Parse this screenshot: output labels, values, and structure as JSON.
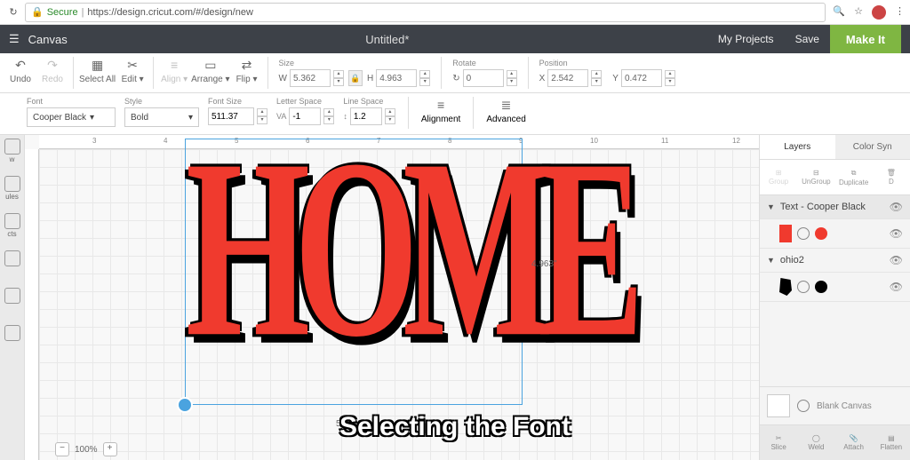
{
  "browser": {
    "secure_label": "Secure",
    "url": "https://design.cricut.com/#/design/new"
  },
  "header": {
    "canvas_label": "Canvas",
    "doc_title": "Untitled*",
    "my_projects": "My Projects",
    "save": "Save",
    "make_it": "Make It"
  },
  "toolbar": {
    "undo": "Undo",
    "redo": "Redo",
    "select_all": "Select All",
    "edit": "Edit",
    "align": "Align",
    "arrange": "Arrange",
    "flip": "Flip",
    "size_label": "Size",
    "w_label": "W",
    "w_value": "5.362",
    "h_label": "H",
    "h_value": "4.963",
    "rotate_label": "Rotate",
    "rotate_value": "0",
    "position_label": "Position",
    "x_label": "X",
    "x_value": "2.542",
    "y_label": "Y",
    "y_value": "0.472"
  },
  "fontbar": {
    "font_label": "Font",
    "font_value": "Cooper Black",
    "style_label": "Style",
    "style_value": "Bold",
    "font_size_label": "Font Size",
    "font_size_value": "511.37",
    "letter_space_label": "Letter Space",
    "letter_space_value": "-1",
    "line_space_label": "Line Space",
    "line_space_value": "1.2",
    "alignment_label": "Alignment",
    "advanced_label": "Advanced"
  },
  "left_tools": {
    "new": "w",
    "ules": "ules",
    "cts": "cts"
  },
  "canvas": {
    "design_text": "HOME",
    "dim_h": "4.963\"",
    "dim_w": "5.362\"",
    "ruler_marks": [
      "3",
      "4",
      "5",
      "6",
      "7",
      "8",
      "9",
      "10",
      "11",
      "12"
    ]
  },
  "layers_panel": {
    "tab_layers": "Layers",
    "tab_color": "Color Syn",
    "actions": {
      "group": "Group",
      "ungroup": "UnGroup",
      "duplicate": "Duplicate",
      "delete": "D"
    },
    "items": [
      {
        "name": "Text - Cooper Black",
        "color": "#f03a2e",
        "swatch_shape": "rect"
      },
      {
        "name": "ohio2",
        "color": "#000000",
        "swatch_shape": "blob"
      }
    ],
    "blank_canvas": "Blank Canvas",
    "bottom": {
      "slice": "Slice",
      "weld": "Weld",
      "attach": "Attach",
      "flatten": "Flatten"
    }
  },
  "zoom": {
    "value": "100%"
  },
  "caption": "Selecting the Font"
}
